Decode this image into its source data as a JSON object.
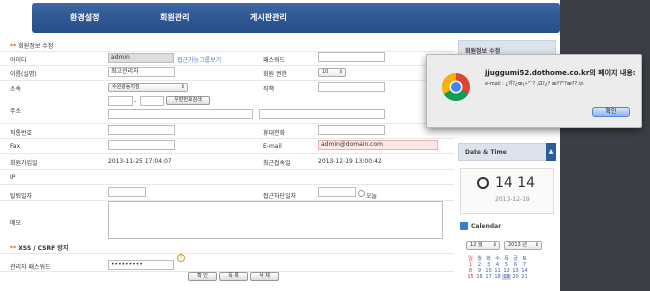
{
  "nav": {
    "items": [
      "환경설정",
      "회원관리",
      "게시판관리"
    ]
  },
  "section1": {
    "title": "회원정보 수정"
  },
  "form": {
    "id_label": "아이디",
    "id_value": "admin",
    "id_link": "접근가능그룹보기",
    "pw_label": "패스워드",
    "name_label": "이름(실명)",
    "name_value": "최고관리자",
    "level_label": "회원 권한",
    "level_value": "10",
    "dept_label": "소속",
    "dept_value": "수원광동지점",
    "rank_label": "직책",
    "addr_label": "주소",
    "zip_sep": "-",
    "zip_button": "우편번호검색",
    "phone_label": "직통번호",
    "mobile_label": "휴대전화",
    "fax_label": "Fax",
    "email_label": "E-mail",
    "email_value": "admin@domain.com",
    "joined_label": "회원가입일",
    "joined_value": "2013-11-25 17:04:07",
    "last_label": "최근접속일",
    "last_value": "2013-12-19 13:00:42",
    "ip_label": "IP",
    "leave_label": "탈퇴일자",
    "block_label": "접근차단일자",
    "today_label": "오늘",
    "memo_label": "메모"
  },
  "section2": {
    "title": "XSS / CSRF 방지"
  },
  "admin_pw": {
    "label": "관리자 패스워드",
    "value": "•••••••••",
    "help": "?"
  },
  "buttons": {
    "confirm": "확 인",
    "list": "목 록",
    "delete": "삭 제"
  },
  "sidebar": {
    "panel1_title": "회원정보 수정",
    "panel2_title": "Date & Time",
    "panel2_btn": "▲",
    "time": "14 14",
    "date": "2013-12-19",
    "calendar_title": "Calendar",
    "cal_month": "12 월",
    "cal_year": "2013 년",
    "weekdays": [
      "일",
      "월",
      "화",
      "수",
      "목",
      "금",
      "토"
    ],
    "row1": [
      "1",
      "2",
      "3",
      "4",
      "5",
      "6",
      "7"
    ],
    "row2": [
      "8",
      "9",
      "10",
      "11",
      "12",
      "13",
      "14"
    ],
    "row3": [
      "15",
      "16",
      "17",
      "18",
      "19",
      "20",
      "21"
    ]
  },
  "alert": {
    "title": "jjuggumi52.dothome.co.kr의 페이지 내용:",
    "message": "e-mail : ¿?Ï?¿œ¡»\"`? ,Ω?¿? æ??\"?æ??.\\n",
    "ok": "확인"
  }
}
